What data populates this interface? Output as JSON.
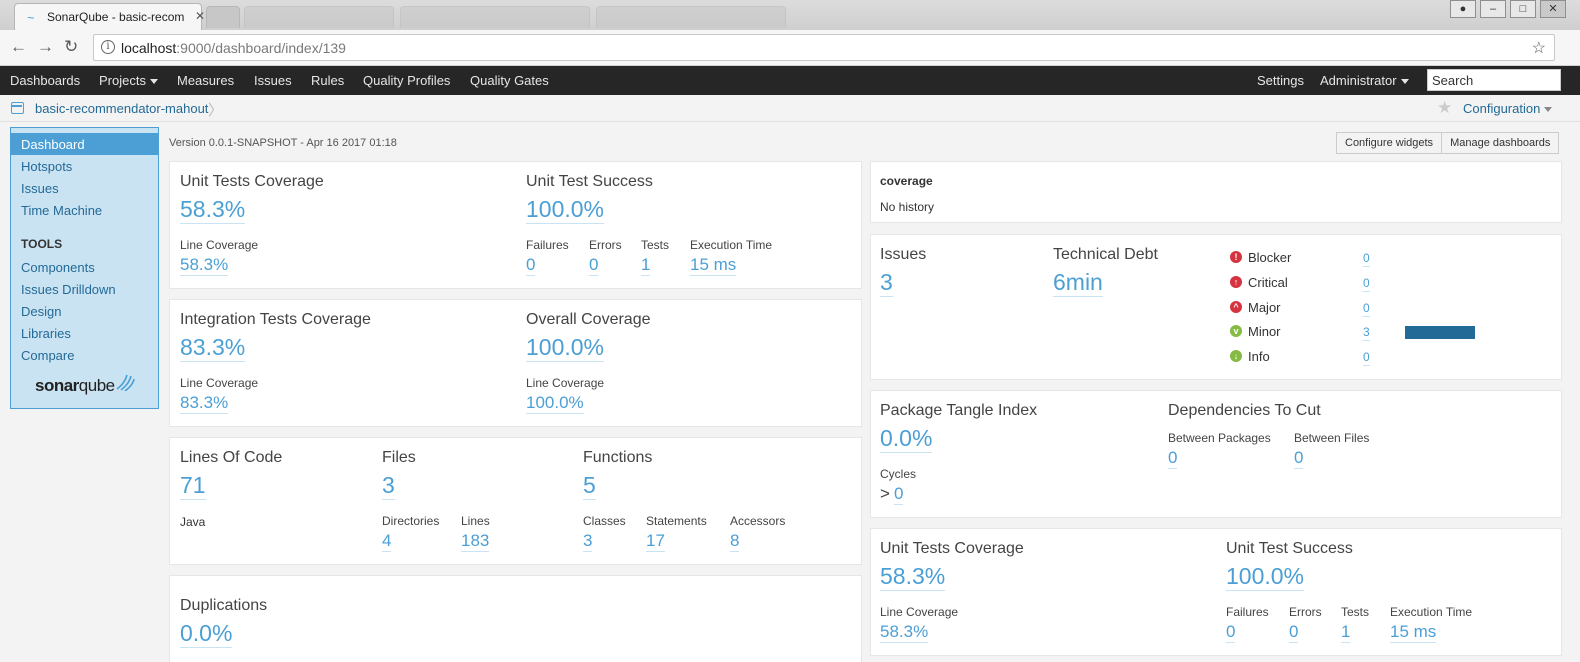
{
  "browser": {
    "tab_title": "SonarQube - basic-recom",
    "url_host": "localhost",
    "url_path": ":9000/dashboard/index/139"
  },
  "topnav": {
    "dashboards": "Dashboards",
    "projects": "Projects",
    "measures": "Measures",
    "issues": "Issues",
    "rules": "Rules",
    "quality_profiles": "Quality Profiles",
    "quality_gates": "Quality Gates",
    "settings": "Settings",
    "administrator": "Administrator",
    "search_placeholder": "Search"
  },
  "breadcrumb": {
    "project": "basic-recommendator-mahout",
    "configuration": "Configuration"
  },
  "sidebar": {
    "items": [
      {
        "label": "Dashboard"
      },
      {
        "label": "Hotspots"
      },
      {
        "label": "Issues"
      },
      {
        "label": "Time Machine"
      }
    ],
    "tools_heading": "TOOLS",
    "tools": [
      {
        "label": "Components"
      },
      {
        "label": "Issues Drilldown"
      },
      {
        "label": "Design"
      },
      {
        "label": "Libraries"
      },
      {
        "label": "Compare"
      }
    ],
    "logo_a": "sonar",
    "logo_b": "qube"
  },
  "header": {
    "version": "Version 0.0.1-SNAPSHOT - Apr 16 2017 01:18",
    "configure_widgets": "Configure widgets",
    "manage_dashboards": "Manage dashboards"
  },
  "tests_left": {
    "unit_cov_title": "Unit Tests Coverage",
    "unit_cov_value": "58.3%",
    "line_cov_label": "Line Coverage",
    "line_cov_value": "58.3%",
    "unit_success_title": "Unit Test Success",
    "unit_success_value": "100.0%",
    "failures_label": "Failures",
    "failures_value": "0",
    "errors_label": "Errors",
    "errors_value": "0",
    "tests_label": "Tests",
    "tests_value": "1",
    "exec_label": "Execution Time",
    "exec_value": "15 ms"
  },
  "integration": {
    "it_title": "Integration Tests Coverage",
    "it_value": "83.3%",
    "it_line_label": "Line Coverage",
    "it_line_value": "83.3%",
    "overall_title": "Overall Coverage",
    "overall_value": "100.0%",
    "overall_line_label": "Line Coverage",
    "overall_line_value": "100.0%"
  },
  "size": {
    "loc_title": "Lines Of Code",
    "loc_value": "71",
    "language": "Java",
    "files_title": "Files",
    "files_value": "3",
    "directories_label": "Directories",
    "directories_value": "4",
    "lines_label": "Lines",
    "lines_value": "183",
    "functions_title": "Functions",
    "functions_value": "5",
    "classes_label": "Classes",
    "classes_value": "3",
    "statements_label": "Statements",
    "statements_value": "17",
    "accessors_label": "Accessors",
    "accessors_value": "8"
  },
  "duplications": {
    "title": "Duplications",
    "value": "0.0%"
  },
  "coverage_history": {
    "title": "coverage",
    "text": "No history"
  },
  "issues": {
    "issues_title": "Issues",
    "issues_value": "3",
    "debt_title": "Technical Debt",
    "debt_value": "6min",
    "severities": [
      {
        "name": "Blocker",
        "count": "0",
        "color": "#d4333f",
        "icon": "!",
        "fraction": 0
      },
      {
        "name": "Critical",
        "count": "0",
        "color": "#d4333f",
        "icon": "↑",
        "fraction": 0
      },
      {
        "name": "Major",
        "count": "0",
        "color": "#d4333f",
        "icon": "^",
        "fraction": 0
      },
      {
        "name": "Minor",
        "count": "3",
        "color": "#85bb43",
        "icon": "v",
        "fraction": 1
      },
      {
        "name": "Info",
        "count": "0",
        "color": "#85bb43",
        "icon": "↓",
        "fraction": 0
      }
    ]
  },
  "design": {
    "tangle_title": "Package Tangle Index",
    "tangle_value": "0.0%",
    "cycles_label": "Cycles",
    "cycles_value": "0",
    "cycles_prefix": "> ",
    "deps_title": "Dependencies To Cut",
    "between_packages_label": "Between Packages",
    "between_packages_value": "0",
    "between_files_label": "Between Files",
    "between_files_value": "0"
  },
  "tests_right": {
    "unit_cov_title": "Unit Tests Coverage",
    "unit_cov_value": "58.3%",
    "line_cov_label": "Line Coverage",
    "line_cov_value": "58.3%",
    "unit_success_title": "Unit Test Success",
    "unit_success_value": "100.0%",
    "failures_label": "Failures",
    "failures_value": "0",
    "errors_label": "Errors",
    "errors_value": "0",
    "tests_label": "Tests",
    "tests_value": "1",
    "exec_label": "Execution Time",
    "exec_value": "15 ms"
  }
}
